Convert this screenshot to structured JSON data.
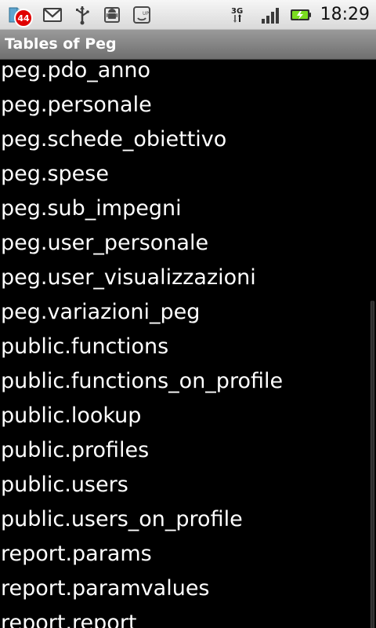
{
  "status_bar": {
    "notification_count": "44",
    "time": "18:29",
    "network_type": "3G",
    "icons": [
      "notification-badge-icon",
      "gmail-icon",
      "usb-icon",
      "android-debug-icon",
      "phone-update-icon",
      "network-3g-icon",
      "signal-strength-icon",
      "battery-charging-icon"
    ]
  },
  "title_bar": {
    "title": "Tables of Peg"
  },
  "list": {
    "items": [
      "peg.pdo_anno",
      "peg.personale",
      "peg.schede_obiettivo",
      "peg.spese",
      "peg.sub_impegni",
      "peg.user_personale",
      "peg.user_visualizzazioni",
      "peg.variazioni_peg",
      "public.functions",
      "public.functions_on_profile",
      "public.lookup",
      "public.profiles",
      "public.users",
      "public.users_on_profile",
      "report.params",
      "report.paramvalues",
      "report.report"
    ]
  },
  "colors": {
    "background": "#000000",
    "text": "#ffffff",
    "status_bar": "#e6e6e6",
    "title_bar": "#8a8a8a",
    "badge": "#e00000",
    "battery": "#7bdc1f"
  }
}
